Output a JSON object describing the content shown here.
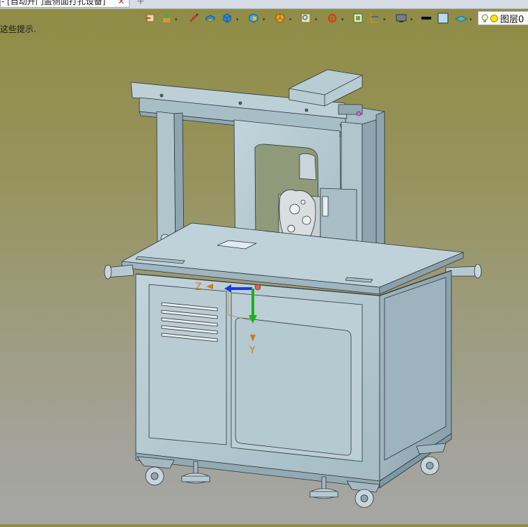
{
  "tab": {
    "title": "- [自动开门盖侧面打孔设备]",
    "close_glyph": "✕",
    "add_glyph": "+"
  },
  "hint_text": "这些提示.",
  "toolbar": {
    "icons": [
      "import-icon",
      "assembly-icon",
      "sketch-pen-icon",
      "extrude-icon",
      "solid-box-icon",
      "part-icon",
      "pie-icon",
      "zoom-fit-icon",
      "rotate-icon",
      "view-orient-icon",
      "section-icon",
      "display-mode-icon",
      "line-color-icon",
      "face-color-icon",
      "plane-icon"
    ],
    "layer_label": "图层0"
  },
  "triad": {
    "z_label": "Z",
    "y_label": "Y"
  },
  "colors": {
    "machine_face": "#b3c8d0",
    "machine_dark": "#8ea7b1",
    "edge": "#2c3438",
    "axis_z": "#1b39e0",
    "axis_y": "#18b418",
    "axis_label": "#cc7a1a"
  }
}
